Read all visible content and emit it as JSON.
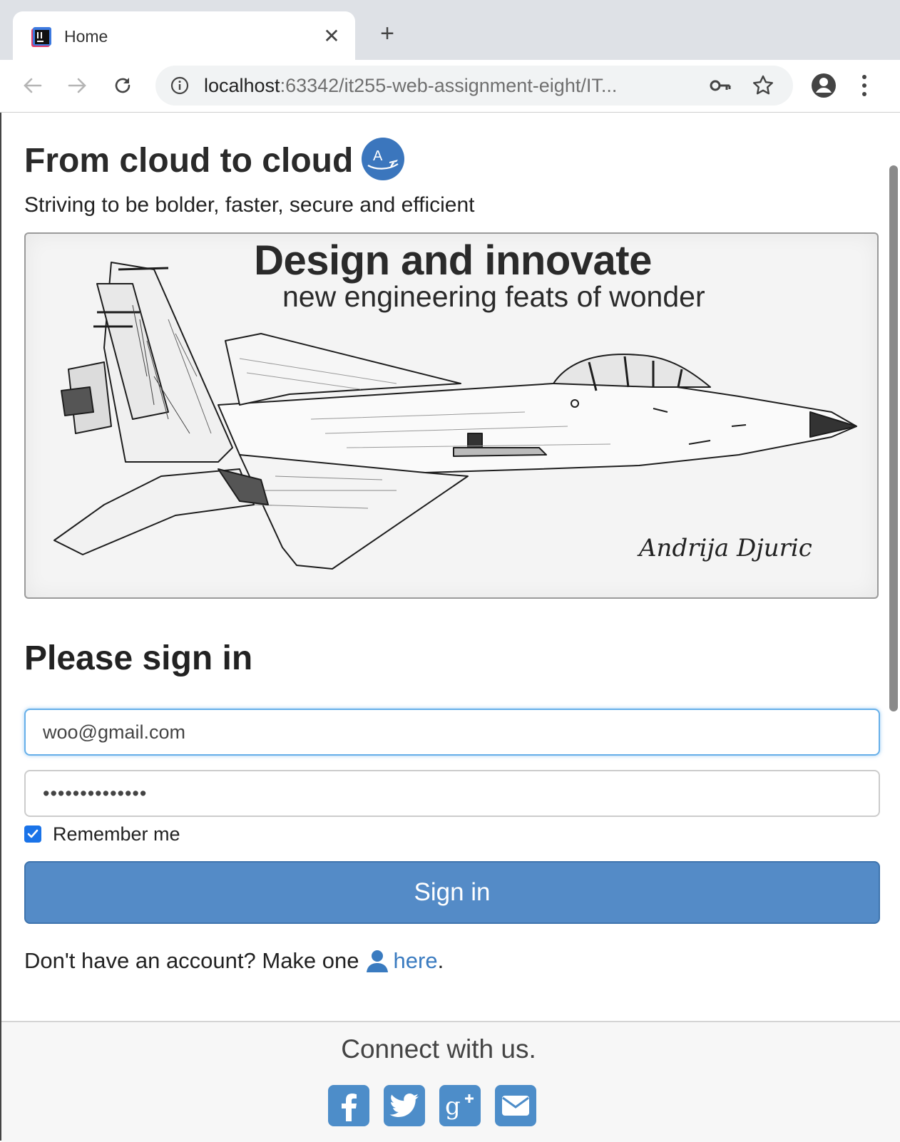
{
  "browser": {
    "tab": {
      "title": "Home",
      "close_glyph": "✕"
    },
    "new_tab_glyph": "+",
    "address": {
      "host": "localhost",
      "rest": ":63342/it255-web-assignment-eight/IT..."
    },
    "icons": [
      "back-icon",
      "forward-icon",
      "reload-icon",
      "info-icon",
      "key-icon",
      "star-icon",
      "profile-icon",
      "menu-icon"
    ]
  },
  "header": {
    "title": "From cloud to cloud",
    "tagline": "Striving to be bolder, faster, secure and efficient"
  },
  "hero": {
    "heading": "Design and innovate",
    "subheading": "new engineering feats of wonder",
    "signature": "Andrija Djuric"
  },
  "signin": {
    "title": "Please sign in",
    "email_value": "woo@gmail.com",
    "password_value": "••••••••••••••",
    "remember_label": "Remember me",
    "remember_checked": true,
    "button_label": "Sign in",
    "signup_prefix": "Don't have an account? Make one",
    "signup_link": "here",
    "signup_suffix": "."
  },
  "footer": {
    "text": "Connect with us.",
    "social": [
      "facebook-icon",
      "twitter-icon",
      "google-plus-icon",
      "email-icon"
    ]
  },
  "colors": {
    "accent": "#548bc7",
    "link": "#3a7bc0",
    "focus": "#66afe9"
  }
}
